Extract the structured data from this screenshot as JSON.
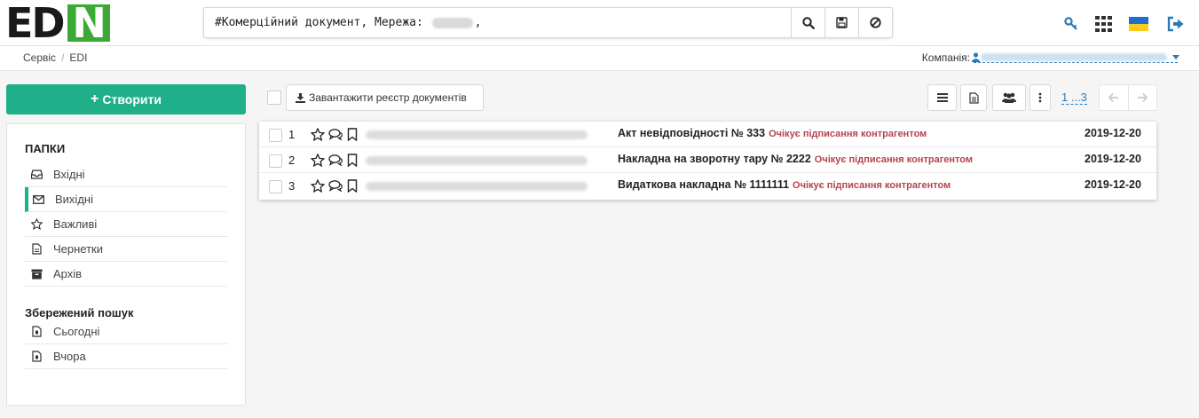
{
  "header": {
    "logo_text": "EDIN",
    "search": {
      "prefix": "#Комерційний документ, Мережа:",
      "suffix": ","
    }
  },
  "breadcrumb": {
    "items": [
      "Сервіс",
      "EDI"
    ]
  },
  "company": {
    "label": "Компанія:"
  },
  "sidebar": {
    "create_label": "Створити",
    "folders_title": "ПАПКИ",
    "folders": [
      {
        "label": "Вхідні",
        "icon": "inbox-icon",
        "active": false
      },
      {
        "label": "Вихідні",
        "icon": "envelope-icon",
        "active": true
      },
      {
        "label": "Важливі",
        "icon": "star-icon",
        "active": false
      },
      {
        "label": "Чернетки",
        "icon": "draft-icon",
        "active": false
      },
      {
        "label": "Архів",
        "icon": "archive-icon",
        "active": false
      }
    ],
    "saved_title": "Збережений пошук",
    "saved": [
      {
        "label": "Сьогодні",
        "icon": "saved-search-icon"
      },
      {
        "label": "Вчора",
        "icon": "saved-search-icon"
      }
    ]
  },
  "toolbar": {
    "upload_label": "Завантажити реєстр документів",
    "pager": "1 ...3"
  },
  "documents": [
    {
      "num": "1",
      "title": "Акт невідповідності № 333",
      "status": "Очікує підписання контрагентом",
      "date": "2019-12-20"
    },
    {
      "num": "2",
      "title": "Накладна на зворотну тару № 2222",
      "status": "Очікує підписання контрагентом",
      "date": "2019-12-20"
    },
    {
      "num": "3",
      "title": "Видаткова накладна № 1111111",
      "status": "Очікує підписання контрагентом",
      "date": "2019-12-20"
    }
  ],
  "colors": {
    "brand_green": "#3aaa35",
    "create_button": "#1fb08a",
    "status_red": "#b4434d",
    "link_blue": "#2a7ab8"
  }
}
